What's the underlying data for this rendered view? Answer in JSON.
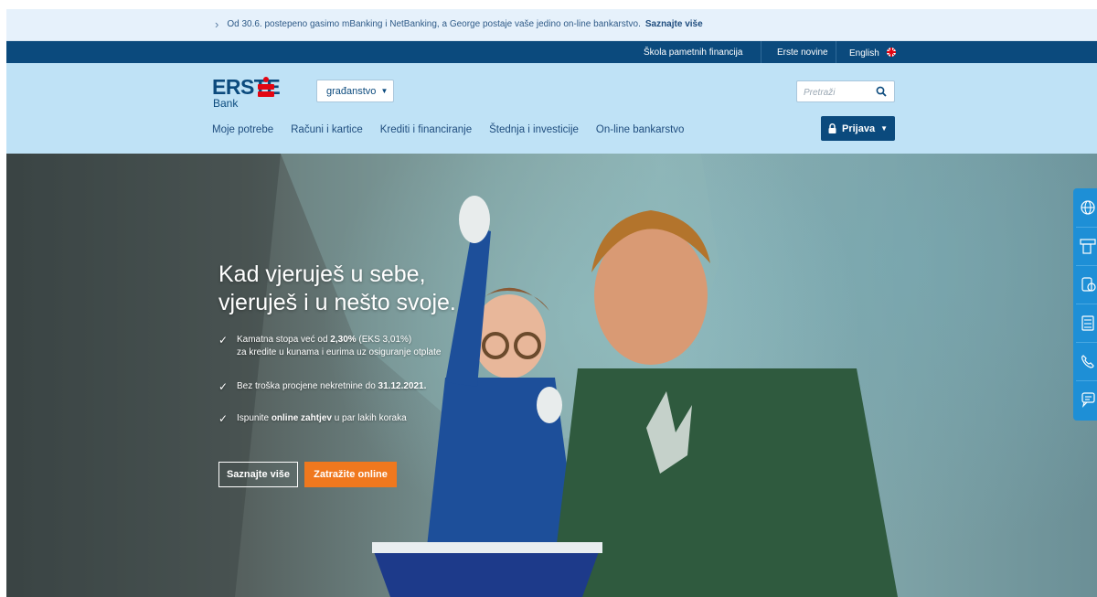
{
  "announcement": {
    "text": "Od 30.6. postepeno gasimo mBanking i NetBanking, a George postaje vaše jedino on-line bankarstvo.",
    "link": "Saznajte više"
  },
  "topbar": {
    "links": [
      "Škola pametnih financija",
      "Erste novine"
    ],
    "language": "English"
  },
  "header": {
    "logo_word": "ERSTE",
    "logo_sub": "Bank",
    "segment": "građanstvo",
    "search_placeholder": "Pretraži",
    "nav": [
      "Moje potrebe",
      "Računi i kartice",
      "Krediti i financiranje",
      "Štednja i investicije",
      "On-line bankarstvo"
    ],
    "login": "Prijava"
  },
  "hero": {
    "title_line1": "Kad vjeruješ u sebe,",
    "title_line2": "vjeruješ i u nešto svoje.",
    "bullets": [
      {
        "pre": "Kamatna stopa već od ",
        "bold": "2,30%",
        "post": " (EKS 3,01%)",
        "line2": "za kredite u kunama i eurima uz osiguranje otplate"
      },
      {
        "pre": "Bez troška procjene nekretnine do ",
        "bold": "31.12.2021.",
        "post": ""
      },
      {
        "pre": "Ispunite ",
        "bold": "online zahtjev",
        "post": " u par lakih koraka"
      }
    ],
    "btn_more": "Saznajte više",
    "btn_online": "Zatražite online"
  },
  "colors": {
    "navy": "#0b4a7d",
    "header_bg": "#bfe2f6",
    "orange": "#f0781e",
    "red": "#e30613",
    "side_blue": "#1e8fd6"
  },
  "side_tools": [
    "globe-icon",
    "atm-icon",
    "coins-icon",
    "calculator-icon",
    "phone-icon",
    "chat-icon"
  ]
}
